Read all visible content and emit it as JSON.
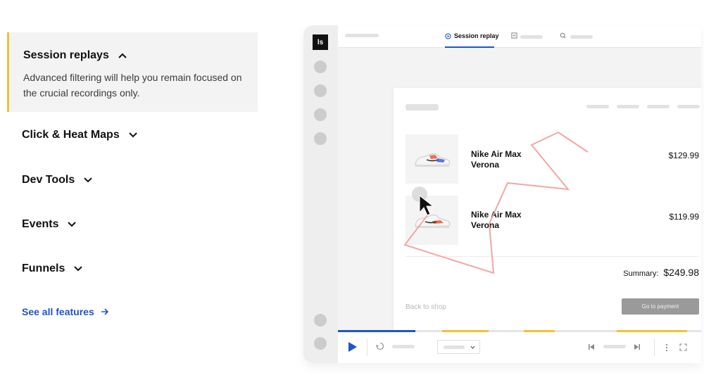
{
  "features": {
    "active": {
      "title": "Session replays",
      "description": "Advanced filtering will help you remain focused on the crucial recordings only."
    },
    "items": [
      {
        "title": "Click & Heat Maps"
      },
      {
        "title": "Dev Tools"
      },
      {
        "title": "Events"
      },
      {
        "title": "Funnels"
      }
    ],
    "see_all": "See all features"
  },
  "app": {
    "logo": "ls",
    "active_tab": "Session replay",
    "products": [
      {
        "name": "Nike Air Max Verona",
        "price": "$129.99"
      },
      {
        "name": "Nike Air Max Verona",
        "price": "$119.99"
      }
    ],
    "summary_label": "Summary:",
    "summary_value": "$249.98",
    "back_link": "Back to shop",
    "pay_button": "Go to payment",
    "colors": {
      "accent": "#1e55c9",
      "highlight": "#f2c230",
      "trail": "#f4a6a6"
    }
  }
}
